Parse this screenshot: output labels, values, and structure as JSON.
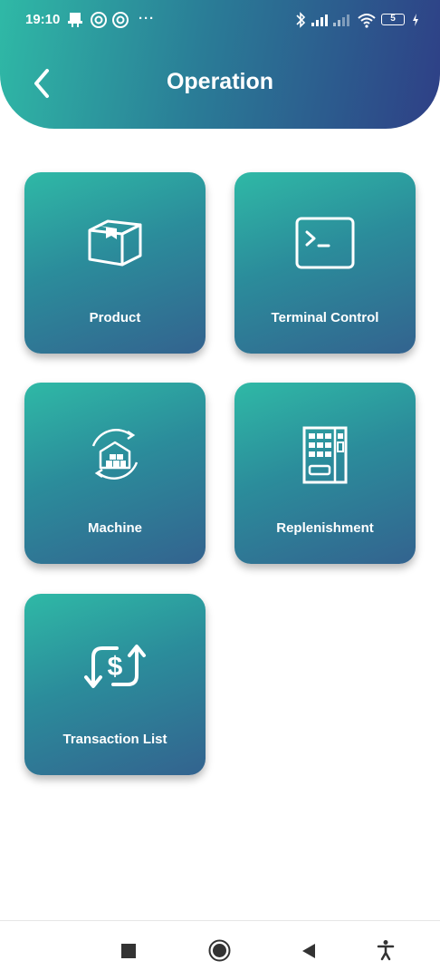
{
  "status_bar": {
    "time": "19:10",
    "more": "···",
    "battery": "5"
  },
  "header": {
    "title": "Operation",
    "gradient": [
      "#2fb9a6",
      "#2a7d97",
      "#2e3f86"
    ]
  },
  "tiles": [
    {
      "label": "Product",
      "icon": "box-icon"
    },
    {
      "label": "Terminal Control",
      "icon": "terminal-icon"
    },
    {
      "label": "Machine",
      "icon": "warehouse-icon"
    },
    {
      "label": "Replenishment",
      "icon": "vending-machine-icon"
    },
    {
      "label": "Transaction List",
      "icon": "dollar-exchange-icon"
    }
  ],
  "tile_colors": [
    "#2fb9a6",
    "#33638f"
  ],
  "nav": {
    "items": [
      "recents-square-icon",
      "home-circle-icon",
      "back-triangle-icon",
      "accessibility-icon"
    ]
  }
}
